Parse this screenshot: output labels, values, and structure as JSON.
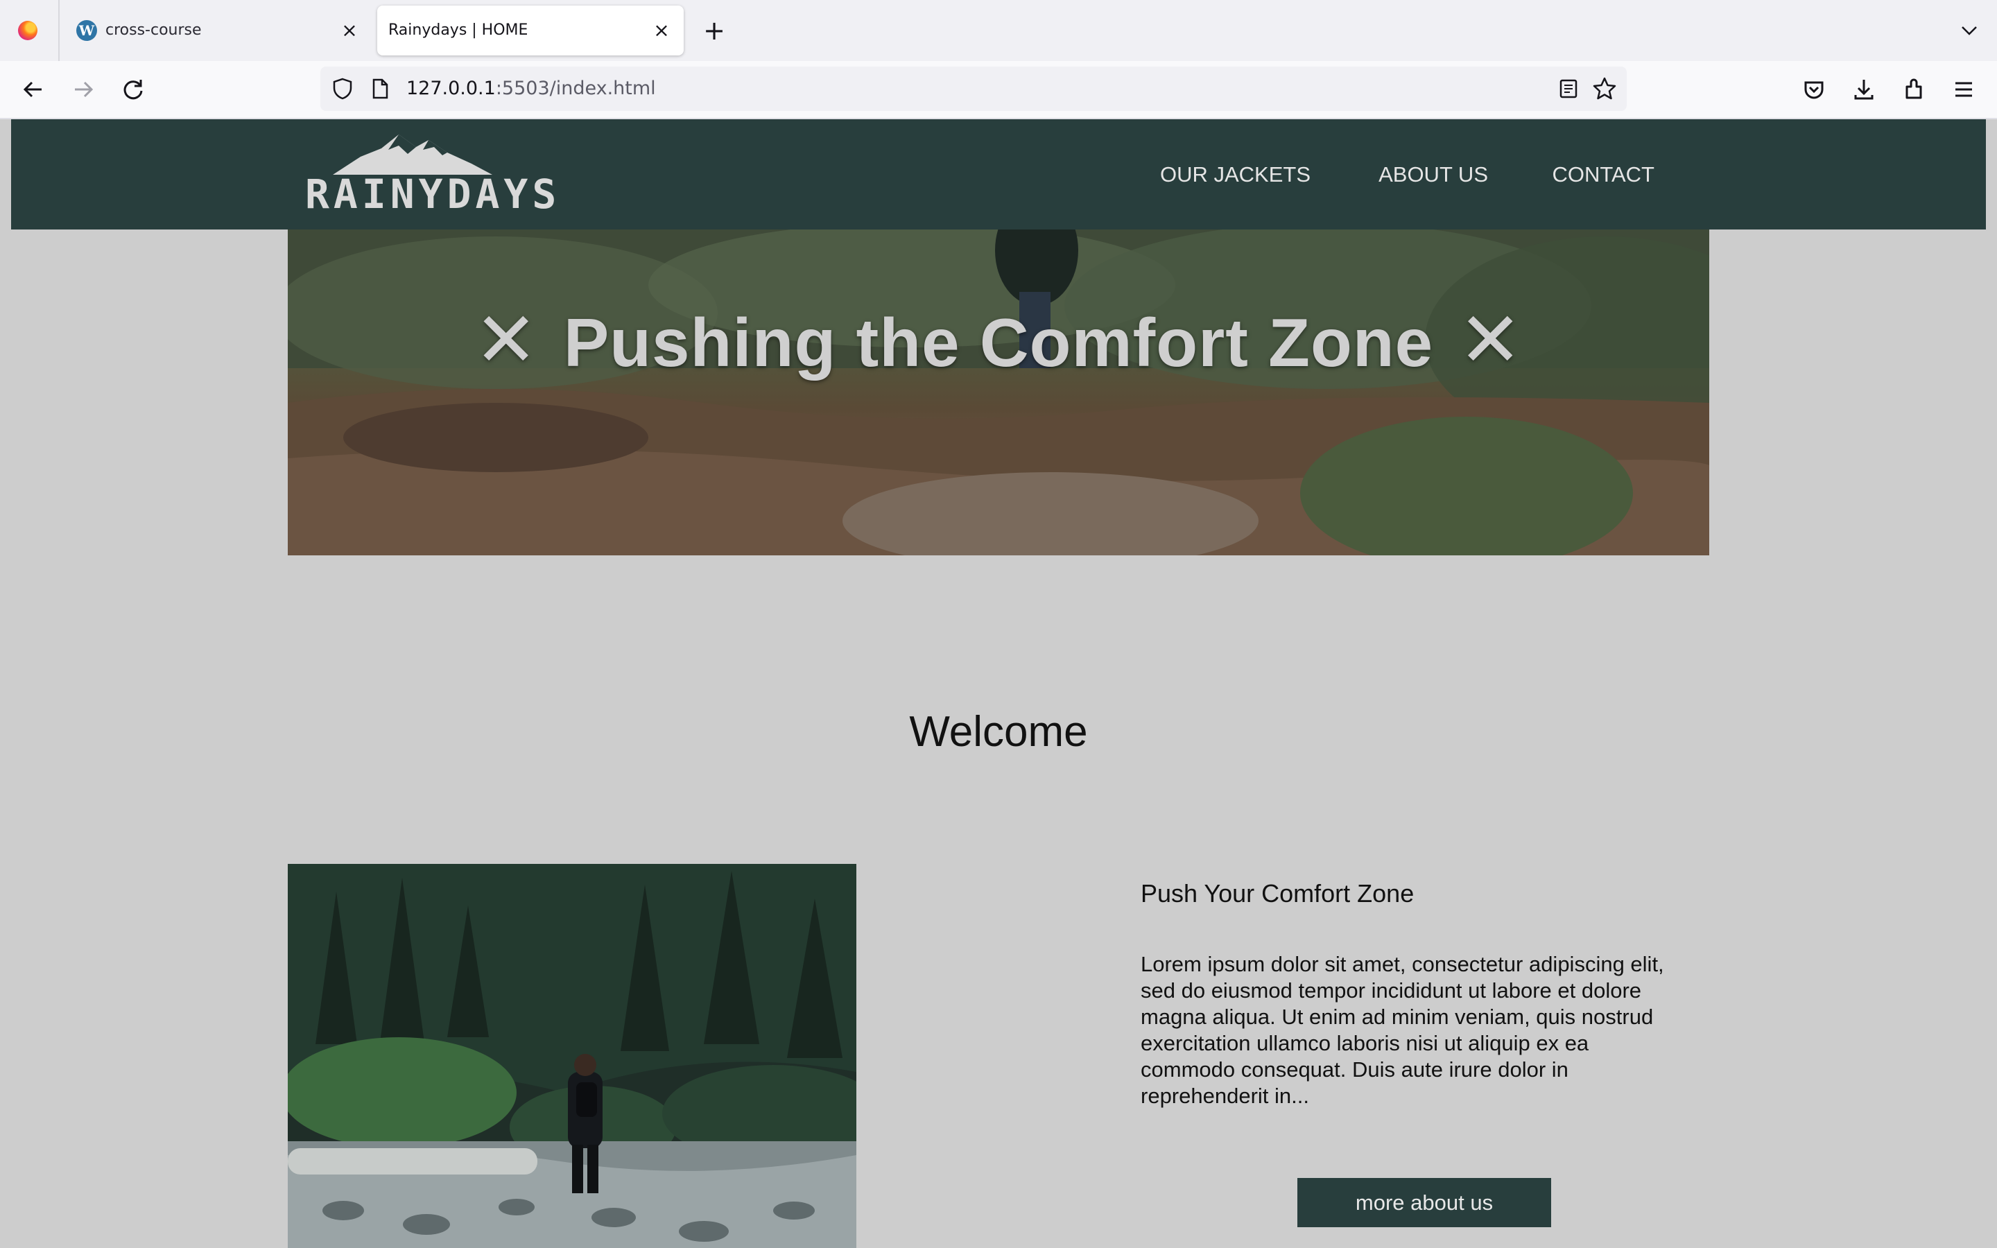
{
  "browser": {
    "tabs": [
      {
        "title": "cross-course",
        "favicon": "wordpress-icon"
      },
      {
        "title": "Rainydays | HOME",
        "active": true
      }
    ],
    "url": {
      "host": "127.0.0.1",
      "rest": ":5503/index.html"
    }
  },
  "site": {
    "logo_text": "RAINYDAYS",
    "nav": [
      "OUR JACKETS",
      "ABOUT US",
      "CONTACT"
    ],
    "hero": {
      "title": "Pushing the Comfort Zone",
      "mark": "✕"
    },
    "welcome": "Welcome",
    "section": {
      "title": "Push Your Comfort Zone",
      "text": "Lorem ipsum dolor sit amet, consectetur adipiscing elit, sed do eiusmod tempor incididunt ut labore et dolore magna aliqua. Ut enim ad minim veniam, quis nostrud exercitation ullamco laboris nisi ut aliquip ex ea commodo consequat. Duis aute irure dolor in reprehenderit in...",
      "button": "more about us"
    }
  },
  "colors": {
    "header_bg": "#283e3d",
    "page_bg": "#cdcdcd",
    "button_bg": "#283e3d"
  }
}
